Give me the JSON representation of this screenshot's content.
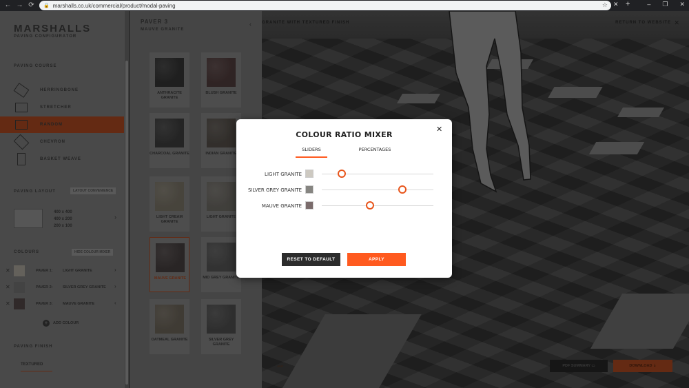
{
  "browser": {
    "url": "marshalls.co.uk/commercial/product/modal-paving",
    "back_icon": "back-arrow-icon",
    "forward_icon": "forward-arrow-icon",
    "reload_icon": "reload-icon",
    "back": "←",
    "forward": "→",
    "reload": "⟳",
    "lock": "🔒",
    "star": "☆",
    "tab_close": "✕",
    "new_tab": "+",
    "minimize": "–",
    "maximize": "❐",
    "close": "✕"
  },
  "sidebar": {
    "brand": "MARSHALLS",
    "brand_sub": "PAVING CONFIGURATOR",
    "course_title": "PAVING COURSE",
    "courses": [
      {
        "label": "HERRINGBONE"
      },
      {
        "label": "STRETCHER"
      },
      {
        "label": "RANDOM"
      },
      {
        "label": "CHEVRON"
      },
      {
        "label": "BASKET WEAVE"
      }
    ],
    "layout_title": "PAVING LAYOUT",
    "layout_tag": "LAYOUT CONVENIENCE",
    "sizes": [
      "400 x 400",
      "400 x 200",
      "200 x 100"
    ],
    "colours_title": "COLOURS",
    "colours_tag": "HIDE COLOUR MIXER",
    "colours": [
      {
        "paver": "PAVER 1:",
        "name": "LIGHT GRANITE",
        "colour": "#7b776f",
        "chevron": "›"
      },
      {
        "paver": "PAVER 2:",
        "name": "SILVER GREY GRANITE",
        "colour": "#525252",
        "chevron": "›"
      },
      {
        "paver": "PAVER 3:",
        "name": "MAUVE GRANITE",
        "colour": "#3b3333",
        "chevron": "‹"
      }
    ],
    "add_colour": "ADD COLOUR",
    "finish_title": "PAVING FINISH",
    "finish_value": "TEXTURED",
    "remove_icon": "✕",
    "layout_chevron": "›"
  },
  "swatch_panel": {
    "title": "PAVER 3",
    "subtitle": "MAUVE GRANITE",
    "close_chevron": "‹",
    "swatches": [
      {
        "name": "ANTHRACITE GRANITE",
        "colour": "#262626"
      },
      {
        "name": "BLUSH GRANITE",
        "colour": "#3a2c2c"
      },
      {
        "name": "CHARCOAL GRANITE",
        "colour": "#2d2d2d"
      },
      {
        "name": "INDIAN GRANITE",
        "colour": "#3d3935"
      },
      {
        "name": "LIGHT CREAM GRANITE",
        "colour": "#57534a"
      },
      {
        "name": "LIGHT GRANITE",
        "colour": "#4f4d49"
      },
      {
        "name": "MAUVE GRANITE",
        "colour": "#332e2e"
      },
      {
        "name": "MID GREY GRANITE",
        "colour": "#3d3d3d"
      },
      {
        "name": "OATMEAL GRANITE",
        "colour": "#4d4840"
      },
      {
        "name": "SILVER GREY GRANITE",
        "colour": "#393939"
      }
    ]
  },
  "scene": {
    "label": "GRANITE WITH TEXTURED FINISH",
    "return": "RETURN TO WEBSITE",
    "return_close": "✕",
    "pdf_summary": "PDF SUMMARY",
    "download": "DOWNLOAD"
  },
  "modal": {
    "title": "COLOUR RATIO MIXER",
    "close": "✕",
    "tabs": [
      {
        "label": "SLIDERS",
        "active": true
      },
      {
        "label": "PERCENTAGES",
        "active": false
      }
    ],
    "sliders": [
      {
        "label": "LIGHT GRANITE",
        "colour": "#cdc9c1",
        "value": 0.18
      },
      {
        "label": "SILVER GREY GRANITE",
        "colour": "#868581",
        "value": 0.72
      },
      {
        "label": "MAUVE GRANITE",
        "colour": "#7a6b6b",
        "value": 0.43
      }
    ],
    "reset_label": "RESET TO DEFAULT",
    "apply_label": "APPLY",
    "accent": "#ff5a1f"
  }
}
